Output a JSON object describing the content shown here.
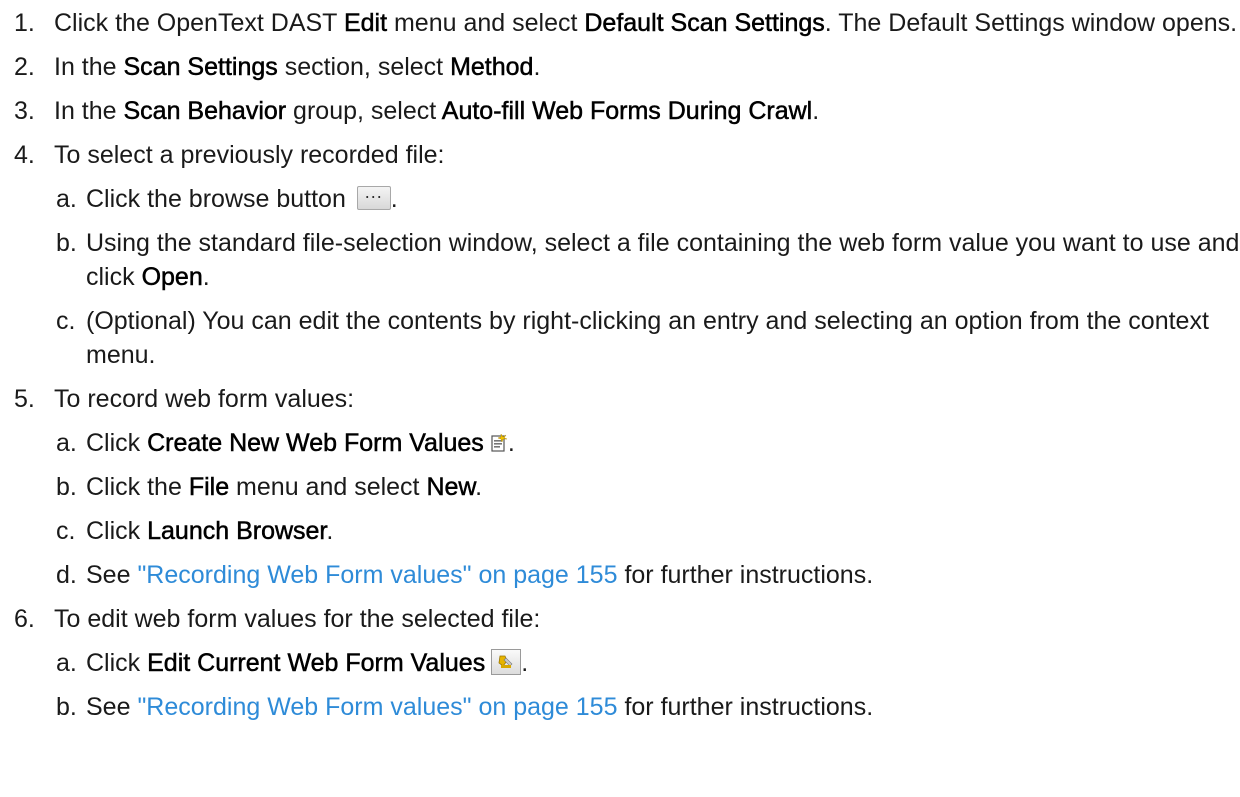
{
  "steps": [
    {
      "num": "1.",
      "p1": "Click the OpenText DAST ",
      "b1": "Edit",
      "p2": " menu and select ",
      "b2": "Default Scan Settings",
      "p3": ". The Default Settings window opens."
    },
    {
      "num": "2.",
      "p1": "In the ",
      "b1": "Scan Settings",
      "p2": " section, select ",
      "b2": "Method",
      "p3": "."
    },
    {
      "num": "3.",
      "p1": "In the ",
      "b1": "Scan Behavior",
      "p2": " group, select ",
      "b2": "Auto-fill Web Forms During Crawl",
      "p3": "."
    },
    {
      "num": "4.",
      "text": "To select a previously recorded file:",
      "subs": [
        {
          "letter": "a.",
          "p1": "Click the browse button ",
          "p2": "."
        },
        {
          "letter": "b.",
          "p1": "Using the standard file-selection window, select a file containing the web form value you want to use and click ",
          "b1": "Open",
          "p2": "."
        },
        {
          "letter": "c.",
          "text": "(Optional) You can edit the contents by right-clicking an entry and selecting an option from the context menu."
        }
      ]
    },
    {
      "num": "5.",
      "text": "To record web form values:",
      "subs": [
        {
          "letter": "a.",
          "p1": "Click ",
          "b1": "Create New Web Form Values",
          "p2": "."
        },
        {
          "letter": "b.",
          "p1": "Click the ",
          "b1": "File",
          "p2": " menu and select ",
          "b2": "New",
          "p3": "."
        },
        {
          "letter": "c.",
          "p1": "Click ",
          "b1": "Launch Browser",
          "p2": "."
        },
        {
          "letter": "d.",
          "p1": "See ",
          "link": "\"Recording Web Form values\" on page 155",
          "p2": " for further instructions."
        }
      ]
    },
    {
      "num": "6.",
      "text": "To edit web form values for the selected file:",
      "subs": [
        {
          "letter": "a.",
          "p1": "Click ",
          "b1": "Edit Current Web Form Values",
          "p2": "."
        },
        {
          "letter": "b.",
          "p1": "See ",
          "link": "\"Recording Web Form values\" on page 155",
          "p2": " for further instructions."
        }
      ]
    }
  ],
  "icons": {
    "browse": "ellipsis-button-icon",
    "create_new": "new-web-form-values-icon",
    "edit_current": "edit-web-form-values-icon"
  },
  "colors": {
    "text": "#1a1a1a",
    "link": "#2e8bd8"
  }
}
